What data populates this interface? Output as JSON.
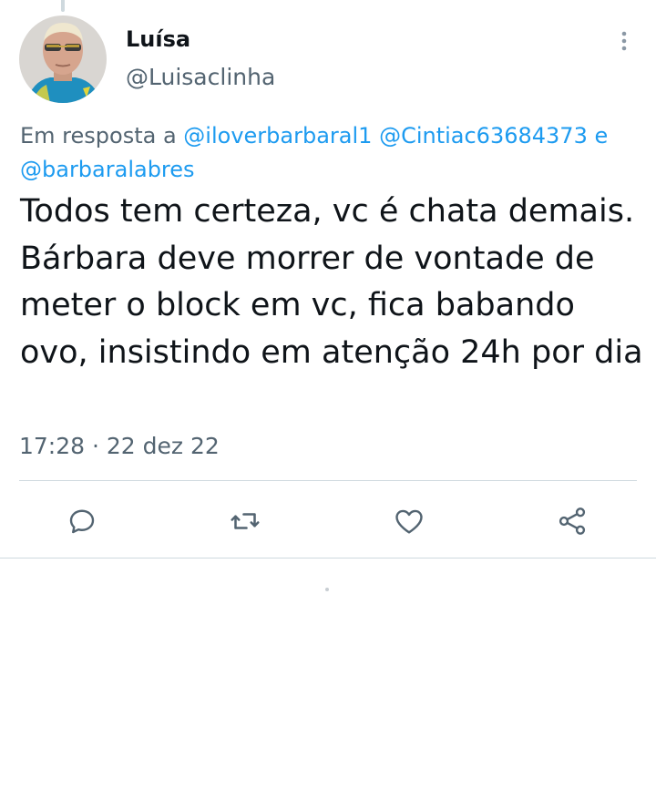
{
  "author": {
    "name": "Luísa",
    "handle": "@Luisaclinha"
  },
  "reply_context": {
    "prefix": "Em resposta a",
    "mention_1": "@iloverbarbaral1",
    "mention_2": "@Cintiac63684373",
    "conjunction": "e",
    "mention_3": "@barbaralabres"
  },
  "tweet": {
    "text": "Todos tem certeza, vc é chata demais. Bárbara deve morrer de vontade de meter o block em vc, fica babando ovo, insistindo em atenção 24h por dia",
    "timestamp": "17:28 · 22 dez 22"
  },
  "actions": [
    {
      "icon": "reply-icon"
    },
    {
      "icon": "retweet-icon"
    },
    {
      "icon": "like-icon"
    },
    {
      "icon": "share-icon"
    }
  ],
  "colors": {
    "text": "#0f1419",
    "secondary": "#536471",
    "link": "#1d9bf0",
    "divider": "#cfd9de"
  }
}
